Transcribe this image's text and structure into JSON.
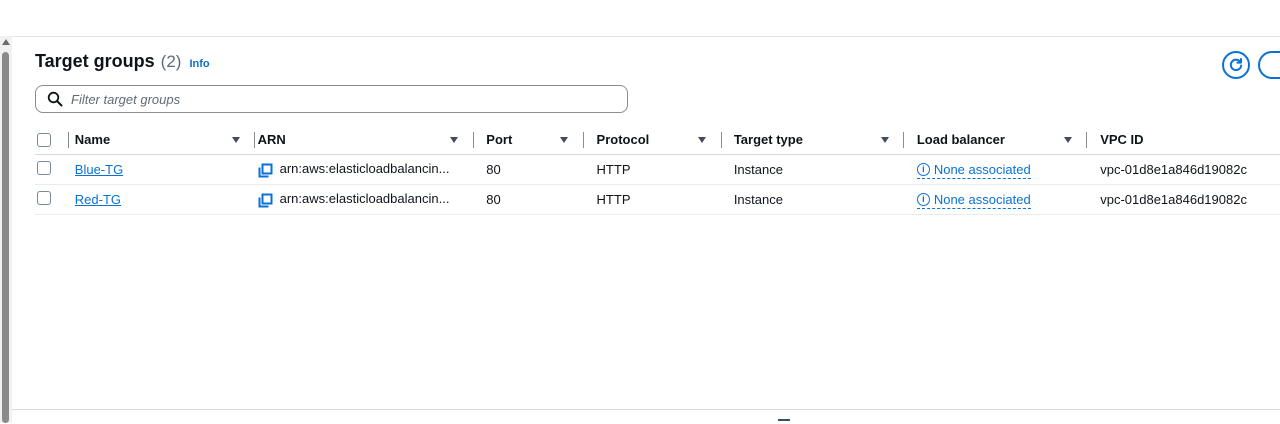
{
  "header": {
    "title": "Target groups",
    "count": "(2)",
    "info": "Info"
  },
  "filter": {
    "placeholder": "Filter target groups",
    "value": ""
  },
  "table": {
    "columns": [
      "Name",
      "ARN",
      "Port",
      "Protocol",
      "Target type",
      "Load balancer",
      "VPC ID"
    ],
    "rows": [
      {
        "name": "Blue-TG",
        "arn": "arn:aws:elasticloadbalancin...",
        "port": "80",
        "protocol": "HTTP",
        "target_type": "Instance",
        "load_balancer": "None associated",
        "vpc_id": "vpc-01d8e1a846d19082c"
      },
      {
        "name": "Red-TG",
        "arn": "arn:aws:elasticloadbalancin...",
        "port": "80",
        "protocol": "HTTP",
        "target_type": "Instance",
        "load_balancer": "None associated",
        "vpc_id": "vpc-01d8e1a846d19082c"
      }
    ]
  },
  "icons": {
    "search": "search-icon",
    "copy": "copy-icon",
    "info": "info-icon",
    "refresh": "refresh-icon",
    "sort": "caret-down-icon"
  },
  "colors": {
    "link": "#0972d3",
    "text": "#0f141a",
    "muted": "#5f6b7a"
  }
}
